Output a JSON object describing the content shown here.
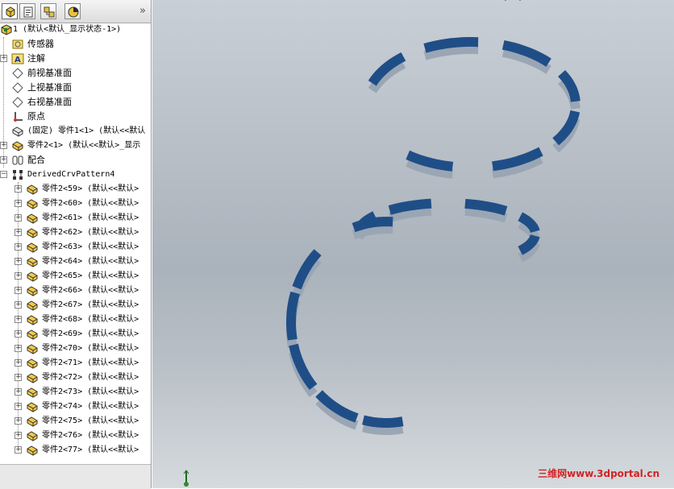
{
  "panel": {
    "tabs": [
      {
        "name": "feature-manager-tab",
        "icon": "feature-tree-icon",
        "active": true
      },
      {
        "name": "property-manager-tab",
        "icon": "property-sheet-icon",
        "active": false
      },
      {
        "name": "configuration-manager-tab",
        "icon": "configuration-icon",
        "active": false
      },
      {
        "name": "display-manager-tab",
        "icon": "appearance-icon",
        "active": false
      }
    ],
    "more_label": "»"
  },
  "tree": {
    "root": "1  (默认<默认_显示状态-1>)",
    "items": [
      {
        "label": "传感器",
        "icon": "sensor-icon"
      },
      {
        "label": "注解",
        "icon": "annotation-icon"
      },
      {
        "label": "前视基准面",
        "icon": "plane-icon"
      },
      {
        "label": "上视基准面",
        "icon": "plane-icon"
      },
      {
        "label": "右视基准面",
        "icon": "plane-icon"
      },
      {
        "label": "原点",
        "icon": "origin-icon"
      },
      {
        "label": "(固定) 零件1<1> (默认<<默认",
        "icon": "part-icon"
      },
      {
        "label": "零件2<1> (默认<<默认>_显示",
        "icon": "part-icon"
      },
      {
        "label": "配合",
        "icon": "mates-icon"
      },
      {
        "label": "DerivedCrvPattern4",
        "icon": "pattern-icon"
      }
    ],
    "instances": [
      {
        "label": "零件2<59> (默认<<默认>"
      },
      {
        "label": "零件2<60> (默认<<默认>"
      },
      {
        "label": "零件2<61> (默认<<默认>"
      },
      {
        "label": "零件2<62> (默认<<默认>"
      },
      {
        "label": "零件2<63> (默认<<默认>"
      },
      {
        "label": "零件2<64> (默认<<默认>"
      },
      {
        "label": "零件2<65> (默认<<默认>"
      },
      {
        "label": "零件2<66> (默认<<默认>"
      },
      {
        "label": "零件2<67> (默认<<默认>"
      },
      {
        "label": "零件2<68> (默认<<默认>"
      },
      {
        "label": "零件2<69> (默认<<默认>"
      },
      {
        "label": "零件2<70> (默认<<默认>"
      },
      {
        "label": "零件2<71> (默认<<默认>"
      },
      {
        "label": "零件2<72> (默认<<默认>"
      },
      {
        "label": "零件2<73> (默认<<默认>"
      },
      {
        "label": "零件2<74> (默认<<默认>"
      },
      {
        "label": "零件2<75> (默认<<默认>"
      },
      {
        "label": "零件2<76> (默认<<默认>"
      },
      {
        "label": "零件2<77> (默认<<默认>"
      }
    ]
  },
  "viewport": {
    "watermark": "三维网www.3dportal.cn",
    "segment_color": "#1f4e87",
    "segment_side_color": "#9aa6b4"
  }
}
